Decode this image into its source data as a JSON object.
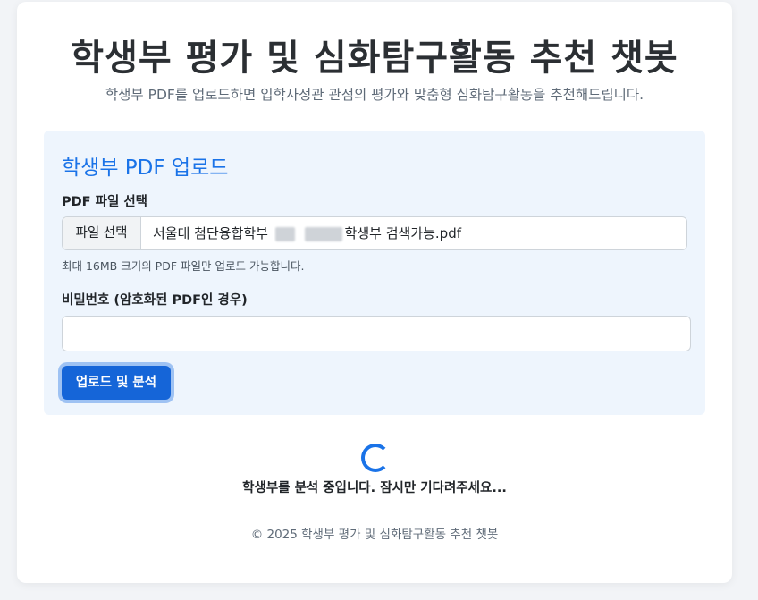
{
  "header": {
    "title": "학생부 평가 및 심화탐구활동 추천 챗봇",
    "subtitle": "학생부 PDF를 업로드하면 입학사정관 관점의 평가와 맞춤형 심화탐구활동을 추천해드립니다."
  },
  "upload": {
    "title": "학생부 PDF 업로드",
    "file_label": "PDF 파일 선택",
    "file_button": "파일 선택",
    "file_name_prefix": "서울대 첨단융합학부",
    "file_name_suffix": "학생부 검색가능.pdf",
    "help_text": "최대 16MB 크기의 PDF 파일만 업로드 가능합니다.",
    "password_label": "비밀번호 (암호화된 PDF인 경우)",
    "password_value": "",
    "submit_label": "업로드 및 분석"
  },
  "loading": {
    "text": "학생부를 분석 중입니다. 잠시만 기다려주세요..."
  },
  "footer": {
    "text": "© 2025 학생부 평가 및 심화탐구활동 추천 챗봇"
  },
  "colors": {
    "accent": "#1a73e8",
    "button": "#1565d8",
    "panel_bg": "#eef5fd"
  }
}
